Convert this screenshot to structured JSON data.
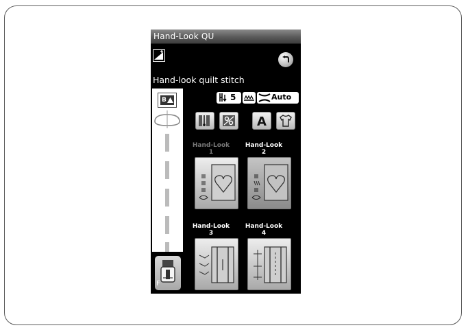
{
  "screen": {
    "title": "Hand-Look QU",
    "stitch_name": "Hand-look quilt stitch"
  },
  "status": {
    "foot_pressure": "5",
    "auto_label": "Auto"
  },
  "mode_buttons": [
    {
      "icon": "needle-position-icon"
    },
    {
      "icon": "memory-icon"
    },
    {
      "icon": "letter-a-icon"
    },
    {
      "icon": "shirt-icon"
    }
  ],
  "patterns": [
    {
      "label_line1": "Hand-Look",
      "label_line2": "1",
      "enabled": false,
      "selected": false,
      "icon": "heart-quilt-1-icon"
    },
    {
      "label_line1": "Hand-Look",
      "label_line2": "2",
      "enabled": true,
      "selected": true,
      "icon": "heart-quilt-2-icon"
    },
    {
      "label_line1": "Hand-Look",
      "label_line2": "3",
      "enabled": true,
      "selected": false,
      "icon": "quilt-3-icon"
    },
    {
      "label_line1": "Hand-Look",
      "label_line2": "4",
      "enabled": true,
      "selected": false,
      "icon": "quilt-4-icon"
    }
  ],
  "foot": {
    "label": "F"
  },
  "preview": {
    "ba_label": "B"
  },
  "colors": {
    "screen_bg": "#000000",
    "title_bar": "#5a5a5a",
    "label_enabled": "#ffffff",
    "label_disabled": "#777777"
  }
}
